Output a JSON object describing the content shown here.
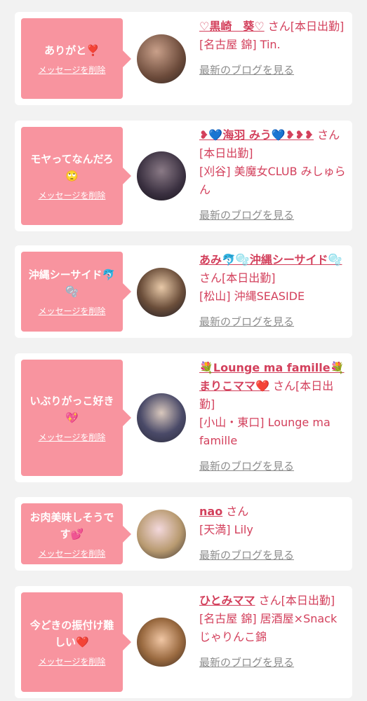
{
  "cards": [
    {
      "message": "ありがと❣️",
      "delete_label": "メッセージを削除",
      "name": "♡黒崎　葵♡",
      "san_status": "さん[本日出勤]",
      "shop": "[名古屋 錦] Tin.",
      "blog_label": "最新のブログを見る"
    },
    {
      "message": "モヤってなんだろ🙄",
      "delete_label": "メッセージを削除",
      "name": "❥💙海羽 みう💙❥❥❥",
      "san_status": "さん[本日出勤]",
      "shop": "[刈谷] 美魔女CLUB みしゅらん",
      "blog_label": "最新のブログを見る"
    },
    {
      "message": "沖縄シーサイド🐬🫧",
      "delete_label": "メッセージを削除",
      "name": "あみ🐬🫧沖縄シーサイド🫧",
      "san_status": "さん[本日出勤]",
      "shop": "[松山] 沖縄SEASIDE",
      "blog_label": "最新のブログを見る"
    },
    {
      "message": "いぶりがっこ好き💖",
      "delete_label": "メッセージを削除",
      "name": "💐Lounge ma famille💐まりこママ❤️",
      "san_status": "さん[本日出勤]",
      "shop": "[小山・東口] Lounge ma famille",
      "blog_label": "最新のブログを見る"
    },
    {
      "message": "お肉美味しそうです💕",
      "delete_label": "メッセージを削除",
      "name": "nao",
      "san_status": "さん",
      "shop": "[天満] Lily",
      "blog_label": "最新のブログを見る"
    },
    {
      "message": "今どきの振付け難しい❤️",
      "delete_label": "メッセージを削除",
      "name": "ひとみママ",
      "san_status": "さん[本日出勤]",
      "shop": "[名古屋 錦] 居酒屋×Snack じゃりんこ錦",
      "blog_label": "最新のブログを見る"
    }
  ],
  "colors": {
    "accent": "#d3405c",
    "bubble": "#f8949f",
    "muted": "#8c8c8c"
  }
}
